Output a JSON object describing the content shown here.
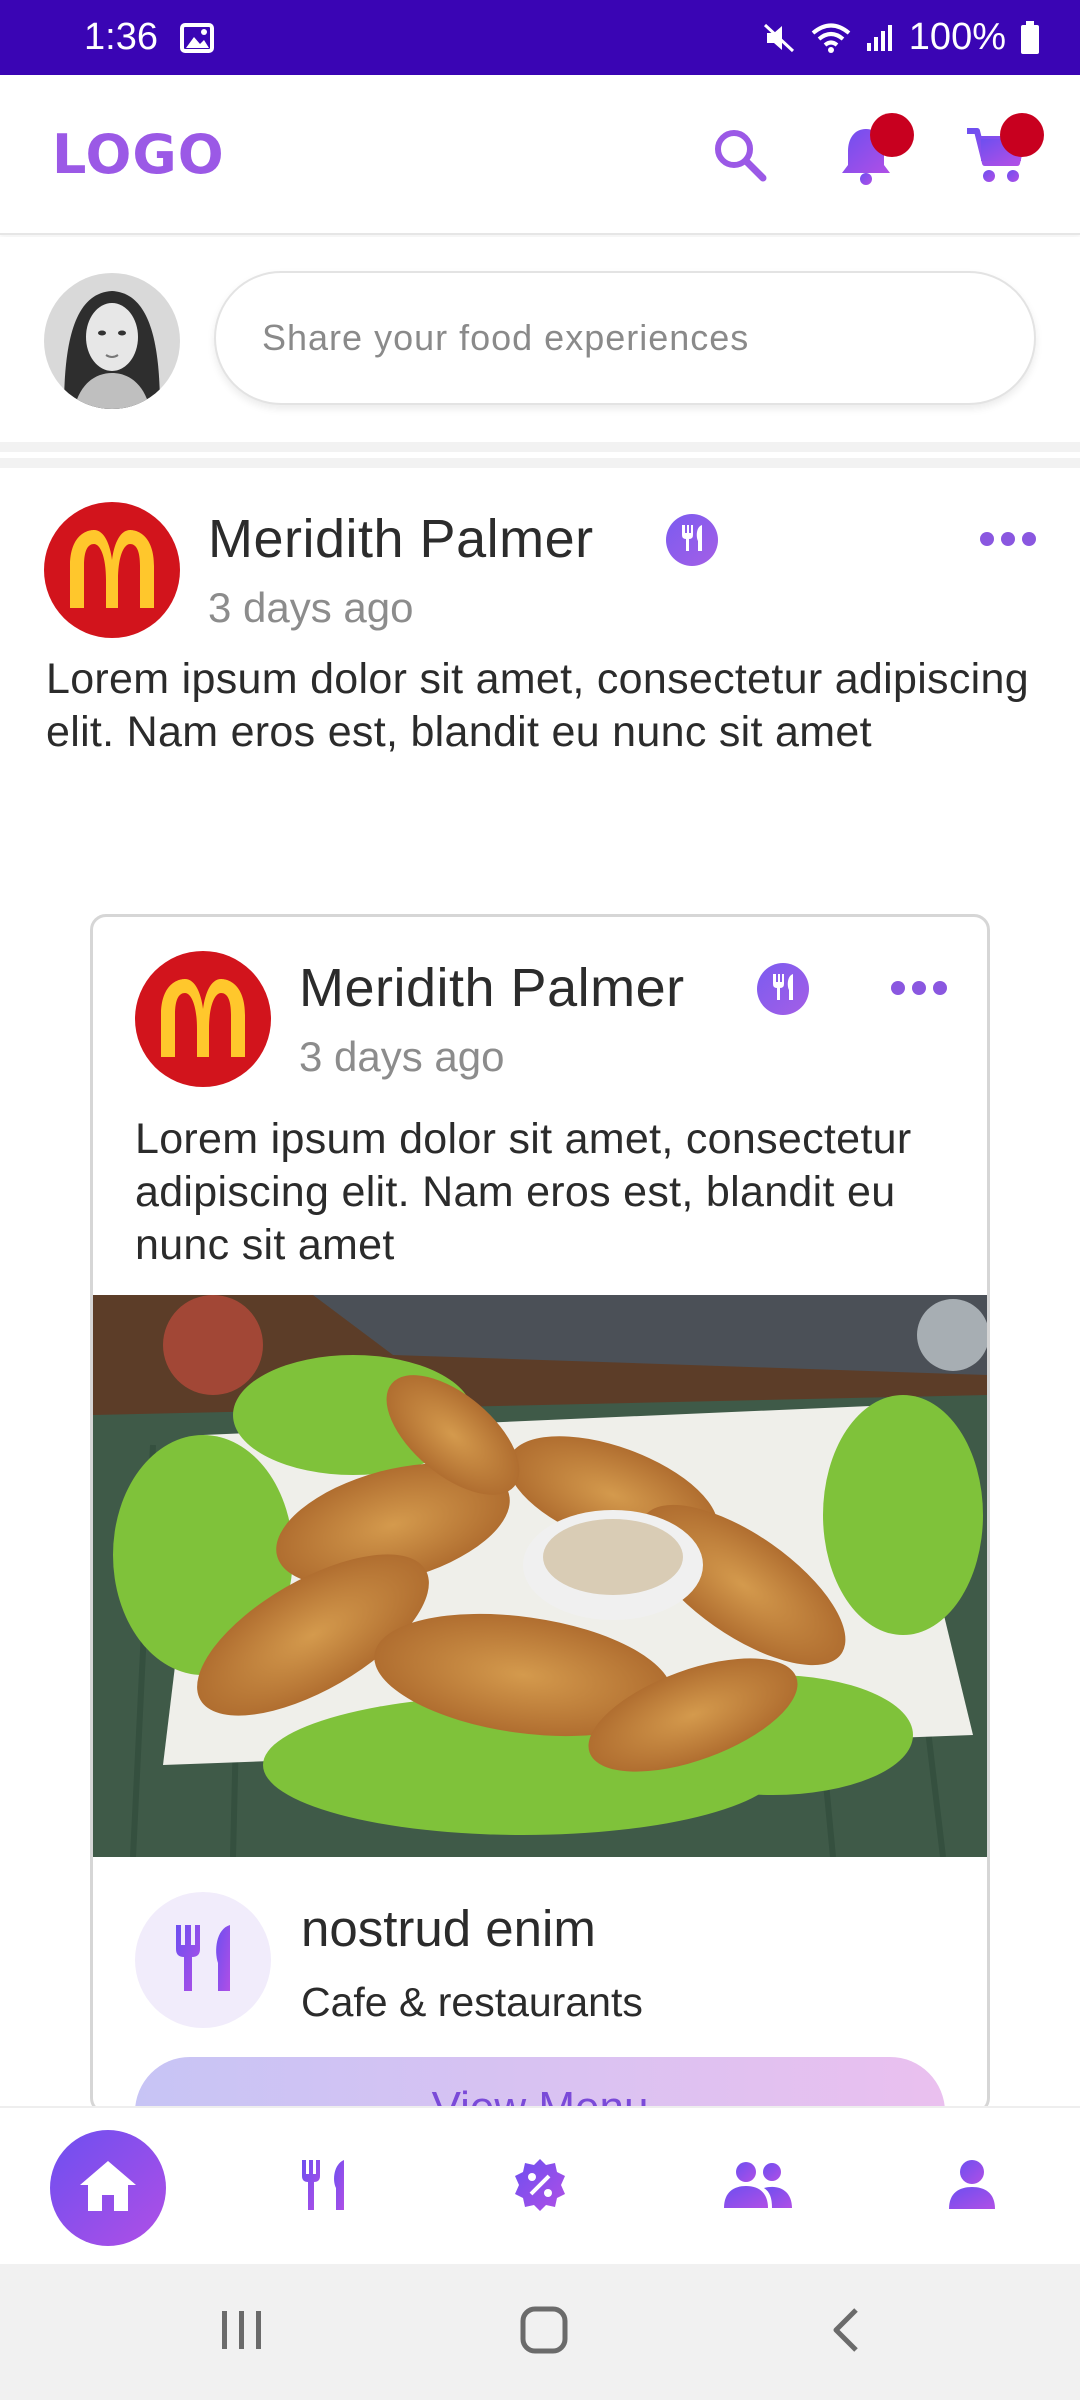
{
  "status_bar": {
    "time": "1:36",
    "battery": "100%",
    "background_color": "#3a05b4"
  },
  "header": {
    "logo_text": "LOGO",
    "brand_color": "#9b59e6",
    "icons": [
      "search-icon",
      "bell-icon",
      "cart-icon"
    ],
    "badge_color": "#c8001f"
  },
  "composer": {
    "placeholder": "Share your food experiences"
  },
  "post": {
    "author": "Meridith Palmer",
    "time": "3 days ago",
    "text": "Lorem ipsum dolor sit amet, consectetur adipiscing elit. Nam eros est, blandit eu nunc sit amet"
  },
  "shared_post": {
    "author": "Meridith Palmer",
    "time": "3 days ago",
    "text": "Lorem ipsum dolor sit amet, consectetur adipiscing elit. Nam eros est, blandit eu nunc sit amet",
    "restaurant": {
      "name": "nostrud enim",
      "category": "Cafe & restaurants"
    },
    "button_label": "View Menu"
  },
  "bottom_nav": {
    "items": [
      "home-icon",
      "restaurant-icon",
      "offers-icon",
      "community-icon",
      "profile-icon"
    ],
    "active": "home-icon"
  },
  "system_nav": {
    "items": [
      "recent-apps-icon",
      "home-button-icon",
      "back-icon"
    ]
  }
}
